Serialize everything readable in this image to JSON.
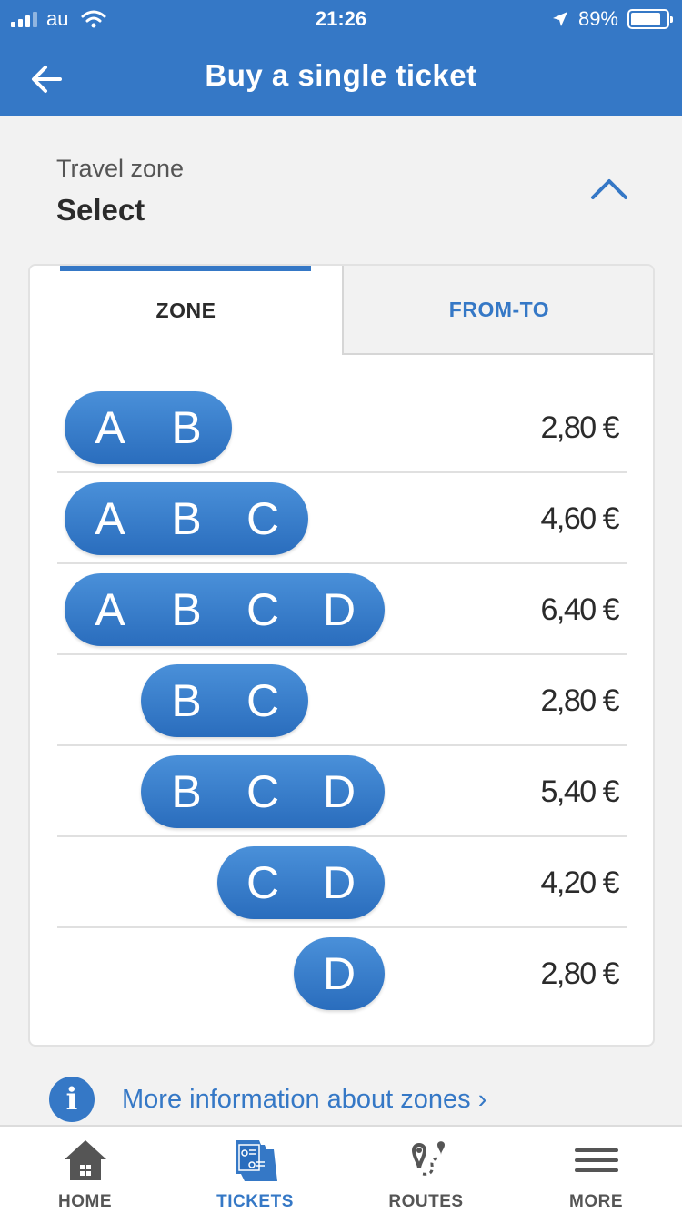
{
  "status": {
    "carrier": "au",
    "time": "21:26",
    "battery": "89%"
  },
  "header": {
    "title": "Buy a single ticket"
  },
  "travel_zone": {
    "label": "Travel zone",
    "value": "Select"
  },
  "tabs": [
    {
      "label": "ZONE",
      "active": true
    },
    {
      "label": "FROM-TO",
      "active": false
    }
  ],
  "zones": [
    {
      "letters": [
        "A",
        "B"
      ],
      "price": "2,80 €"
    },
    {
      "letters": [
        "A",
        "B",
        "C"
      ],
      "price": "4,60 €"
    },
    {
      "letters": [
        "A",
        "B",
        "C",
        "D"
      ],
      "price": "6,40 €"
    },
    {
      "letters": [
        "B",
        "C"
      ],
      "price": "2,80 €"
    },
    {
      "letters": [
        "B",
        "C",
        "D"
      ],
      "price": "5,40 €"
    },
    {
      "letters": [
        "C",
        "D"
      ],
      "price": "4,20 €"
    },
    {
      "letters": [
        "D"
      ],
      "price": "2,80 €"
    }
  ],
  "info_link": {
    "text": "More information about zones ›"
  },
  "bottom_nav": [
    {
      "label": "HOME",
      "icon": "home-icon",
      "active": false
    },
    {
      "label": "TICKETS",
      "icon": "tickets-icon",
      "active": true
    },
    {
      "label": "ROUTES",
      "icon": "routes-icon",
      "active": false
    },
    {
      "label": "MORE",
      "icon": "menu-icon",
      "active": false
    }
  ],
  "colors": {
    "accent": "#3578c6",
    "pill": "#3a80cc",
    "background": "#f2f2f2"
  }
}
